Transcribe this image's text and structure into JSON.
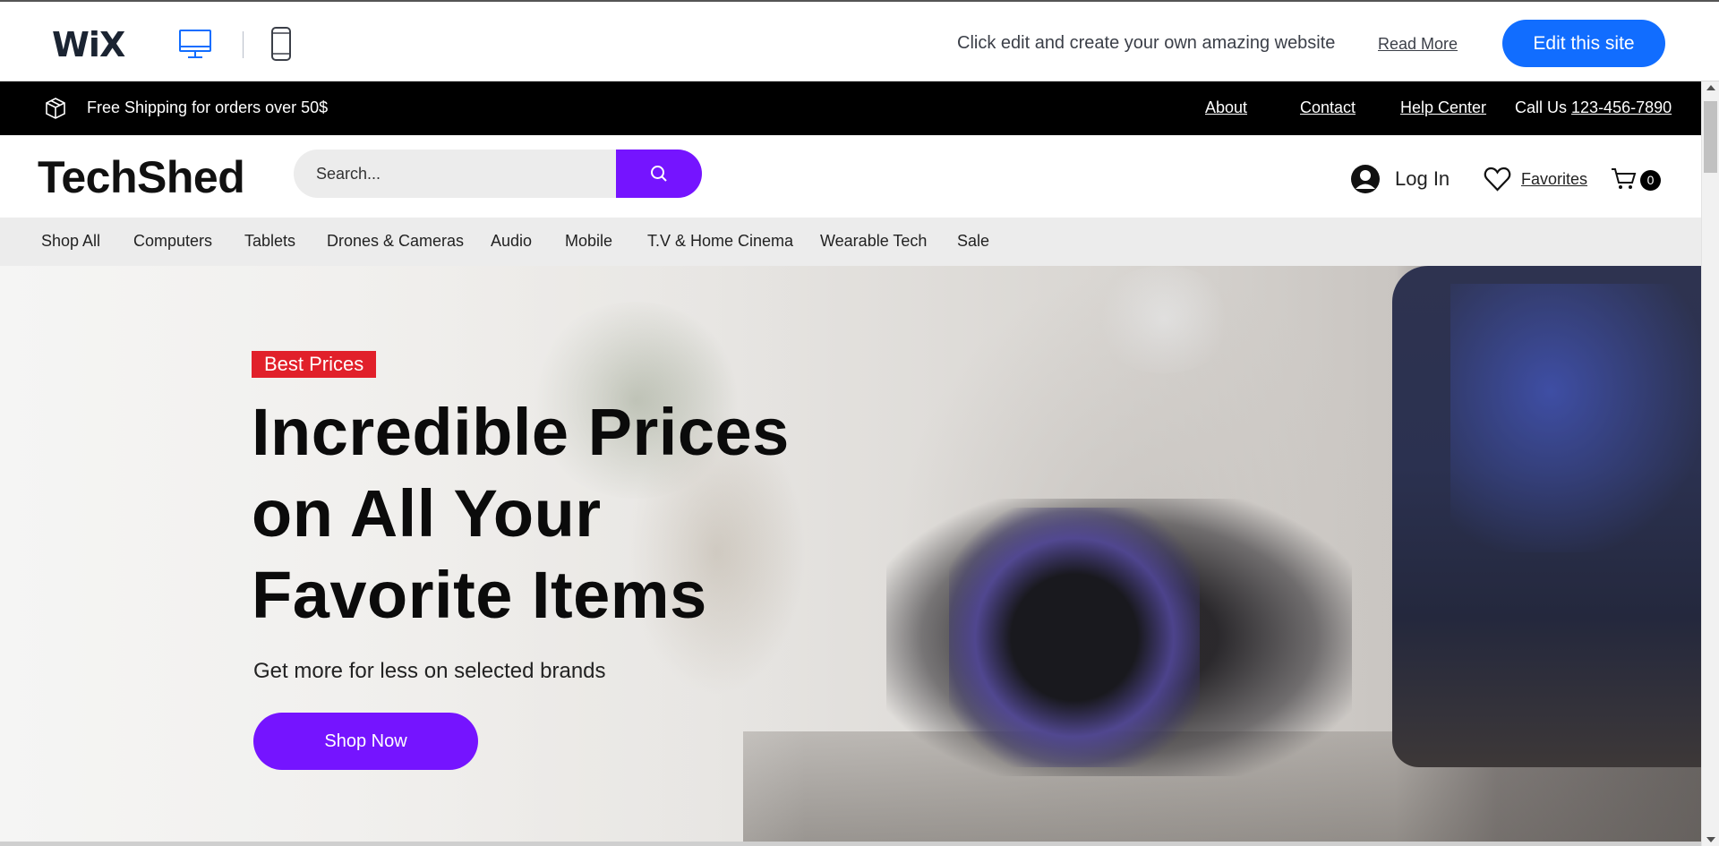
{
  "editor_bar": {
    "logo": "WiX",
    "message": "Click edit and create your own amazing website",
    "read_more": "Read More",
    "edit_button": "Edit this site"
  },
  "top_strip": {
    "shipping": "Free Shipping for orders over 50$",
    "links": [
      "About",
      "Contact",
      "Help Center"
    ],
    "call_label": "Call Us",
    "phone": "123-456-7890"
  },
  "header": {
    "brand": "TechShed",
    "search_placeholder": "Search...",
    "login": "Log In",
    "favorites": "Favorites",
    "cart_count": "0"
  },
  "nav": {
    "items": [
      "Shop All",
      "Computers",
      "Tablets",
      "Drones & Cameras",
      "Audio",
      "Mobile",
      "T.V & Home Cinema",
      "Wearable Tech",
      "Sale"
    ]
  },
  "hero": {
    "badge": "Best Prices",
    "title_lines": [
      "Incredible Prices",
      "on All Your",
      "Favorite Items"
    ],
    "subtitle": "Get more for less on selected brands",
    "cta": "Shop Now"
  },
  "colors": {
    "wix_blue": "#116dff",
    "accent_purple": "#7514ff",
    "badge_red": "#e1202a",
    "nav_bg": "#ececec"
  },
  "icons": {
    "desktop": "desktop-icon",
    "mobile": "mobile-icon",
    "shipping": "package-icon",
    "search": "search-icon",
    "login": "user-avatar-icon",
    "favorites": "heart-icon",
    "cart": "cart-icon"
  }
}
